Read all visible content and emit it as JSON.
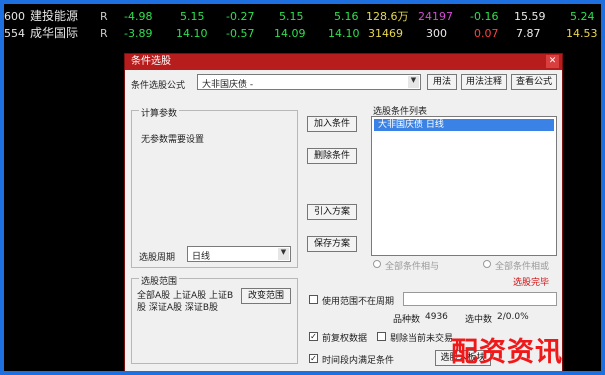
{
  "rows": [
    {
      "code": "600",
      "name": "建投能源",
      "flag": "R",
      "v1": "-4.98",
      "v2": "5.15",
      "v3": "-0.27",
      "v4": "5.15",
      "v5": "5.16",
      "v6": "128.6万",
      "v7": "24197",
      "v8": "-0.16",
      "v9": "15.59",
      "v10": "5.24"
    },
    {
      "code": "554",
      "name": "成华国际",
      "flag": "R",
      "v1": "-3.89",
      "v2": "14.10",
      "v3": "-0.57",
      "v4": "14.09",
      "v5": "14.10",
      "v6": "31469",
      "v7": "300",
      "v8": "0.07",
      "v9": "7.87",
      "v10": "14.53"
    }
  ],
  "dialog": {
    "title": "条件选股",
    "formula_label": "条件选股公式",
    "formula_value": "大非国庆债 -",
    "btn_usage": "用法",
    "btn_comment": "用法注释",
    "btn_view": "查看公式",
    "params_title": "计算参数",
    "params_empty": "无参数需要设置",
    "btn_add": "加入条件",
    "btn_delete": "删除条件",
    "btn_import": "引入方案",
    "btn_save": "保存方案",
    "list_title": "选股条件列表",
    "list_items": [
      "大非国庆债 日线"
    ],
    "period_label": "选股周期",
    "period_value": "日线",
    "radio_all": "全部条件相与",
    "radio_any": "全部条件相或",
    "range_title": "选股范围",
    "range_text": "全部A股 上证A股 上证B股 深证A股 深证B股",
    "btn_change_range": "改变范围",
    "status_text": "选股完毕",
    "chk_use_range": "使用范围不在周期",
    "total_label": "品种数",
    "total_value": "4936",
    "selected_label": "选中数",
    "selected_value": "2/0.0%",
    "chk_pre_data": "前复权数据",
    "chk_remove": "剔除当前未交易",
    "chk_save_block": "时间段内满足条件",
    "btn_to_block": "选股入板块"
  },
  "watermark": "配资资讯"
}
